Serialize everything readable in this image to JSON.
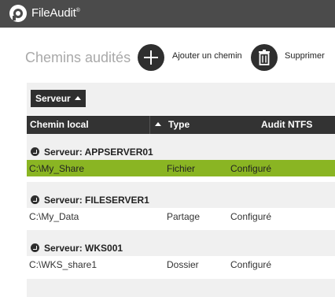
{
  "app": {
    "title": "FileAudit",
    "trademark": "®"
  },
  "page": {
    "title": "Chemins audités"
  },
  "toolbar": {
    "add_label": "Ajouter un chemin",
    "delete_label": "Supprimer"
  },
  "grouping": {
    "group_by_label": "Serveur"
  },
  "grid": {
    "columns": {
      "path": "Chemin local",
      "type": "Type",
      "audit": "Audit NTFS"
    },
    "groups": [
      {
        "label": "Serveur:  APPSERVER01",
        "row": {
          "path": "C:\\My_Share",
          "type": "Fichier",
          "audit": "Configuré",
          "selected": true
        }
      },
      {
        "label": "Serveur:  FILESERVER1",
        "row": {
          "path": "C:\\My_Data",
          "type": "Partage",
          "audit": "Configuré",
          "selected": false
        }
      },
      {
        "label": "Serveur:  WKS001",
        "row": {
          "path": "C:\\WKS_share1",
          "type": "Dossier",
          "audit": "Configuré",
          "selected": false
        }
      }
    ]
  },
  "colors": {
    "accent_selected": "#8ab523",
    "header_bg": "#333333",
    "titlebar_bg": "#4b4b4b"
  }
}
